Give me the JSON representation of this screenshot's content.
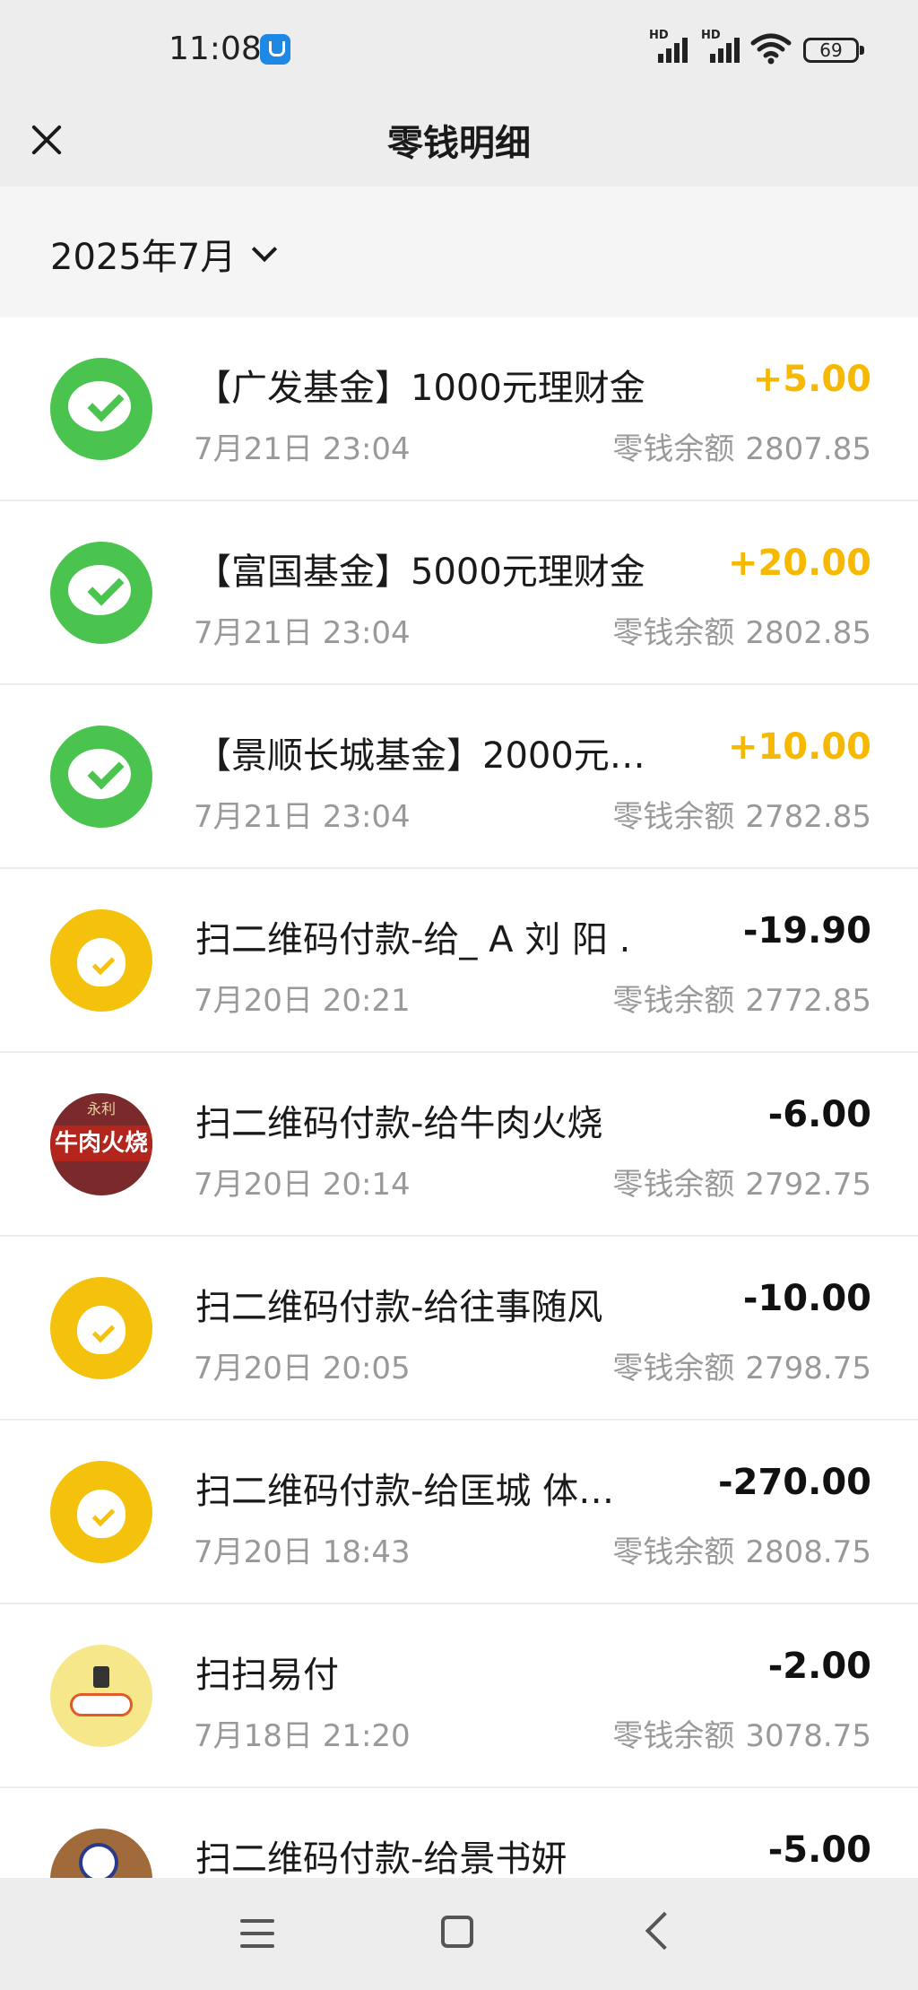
{
  "status_bar": {
    "time": "11:08",
    "signal1_label": "HD",
    "signal2_label": "HD",
    "battery": "69"
  },
  "header": {
    "title": "零钱明细"
  },
  "filter": {
    "month": "2025年7月"
  },
  "balance_label": "零钱余额",
  "transactions": [
    {
      "title": "【广发基金】1000元理财金",
      "time": "7月21日 23:04",
      "amount": "+5.00",
      "balance": "2807.85",
      "icon": "wechat-pay-icon"
    },
    {
      "title": "【富国基金】5000元理财金",
      "time": "7月21日 23:04",
      "amount": "+20.00",
      "balance": "2802.85",
      "icon": "wechat-pay-icon"
    },
    {
      "title": "【景顺长城基金】2000元…",
      "time": "7月21日 23:04",
      "amount": "+10.00",
      "balance": "2782.85",
      "icon": "wechat-pay-icon"
    },
    {
      "title": "扫二维码付款-给_ A 刘 阳 .",
      "time": "7月20日 20:21",
      "amount": "-19.90",
      "balance": "2772.85",
      "icon": "moneybag-icon"
    },
    {
      "title": "扫二维码付款-给牛肉火烧",
      "time": "7月20日 20:14",
      "amount": "-6.00",
      "balance": "2792.75",
      "icon": "shop-photo-avatar",
      "avatar_text_top": "永利",
      "avatar_text": "牛肉火烧"
    },
    {
      "title": "扫二维码付款-给往事随风",
      "time": "7月20日 20:05",
      "amount": "-10.00",
      "balance": "2798.75",
      "icon": "moneybag-icon"
    },
    {
      "title": "扫二维码付款-给匡城 体…",
      "time": "7月20日 18:43",
      "amount": "-270.00",
      "balance": "2808.75",
      "icon": "moneybag-icon"
    },
    {
      "title": "扫扫易付",
      "time": "7月18日 21:20",
      "amount": "-2.00",
      "balance": "3078.75",
      "icon": "scooter-icon"
    },
    {
      "title": "扫二维码付款-给景书妍",
      "time": "",
      "amount": "-5.00",
      "balance": "",
      "icon": "ball-icon"
    }
  ],
  "nav": {
    "menu": "menu-icon",
    "home": "home-icon",
    "back": "back-icon"
  }
}
